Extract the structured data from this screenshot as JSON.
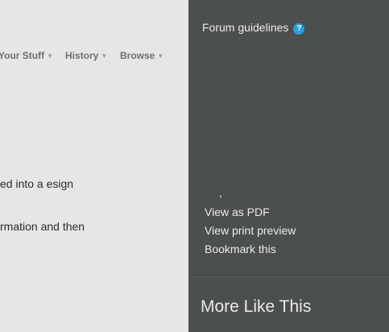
{
  "nav": {
    "items": [
      {
        "label": "Your Stuff"
      },
      {
        "label": "History"
      },
      {
        "label": "Browse"
      }
    ]
  },
  "content": {
    "lines": [
      "ed into a esign",
      "rmation and then"
    ]
  },
  "sidebar": {
    "guidelines_label": "Forum guidelines",
    "help_icon_glyph": "?",
    "stray_mark": ",",
    "links": [
      {
        "label": "View as PDF"
      },
      {
        "label": "View print preview"
      },
      {
        "label": "Bookmark this"
      }
    ],
    "more_title": "More Like This",
    "colors": {
      "background": "#4b4f4e",
      "text": "#e9ebea",
      "help_icon": "#27a0db"
    }
  },
  "colors": {
    "page_background": "#e6e6e6",
    "nav_text": "#6f6f6f",
    "body_text": "#2b2b2b"
  }
}
